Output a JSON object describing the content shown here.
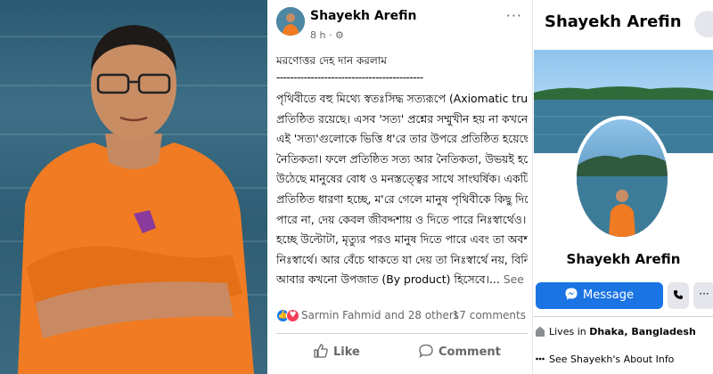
{
  "post": {
    "author": "Shayekh Arefin",
    "time": "8 h",
    "privacy_icon": "gear-icon",
    "more_icon": "more-icon",
    "title": "মরণোত্তর দেহ দান করলাম",
    "divider": "-------------------------------------------",
    "body_lines": [
      "পৃথিবীতে বহু মিথ্যে স্বতঃসিদ্ধ সত্যরূপে (Axiomatic truth)",
      "প্রতিষ্ঠিত রয়েছে। এসব 'সত্য' প্রশ্নের সম্মুখীন হয় না কখনো।",
      "এই 'সত্য'গুলোকে ভিত্তি ধ'রে তার উপরে প্রতিষ্ঠিত হয়েছে বিচিত্র",
      "নৈতিকতা। ফলে প্রতিষ্ঠিত সত্য আর নৈতিকতা, উভয়ই হয়ে",
      "উঠেছে মানুষের বোধ ও মনস্তত্ত্বের সাথে সাংঘর্ষিক। একটি",
      "প্রতিষ্ঠিত ধারণা হচ্ছে, ম'রে গেলে মানুষ পৃথিবীকে কিছু দিতে",
      "পারে না, দেয় কেবল জীবদ্দশায় ও দিতে পারে নিঃস্বার্থেও। সত্য",
      "হচ্ছে উল্টোটা, মৃত্যুর পরও মানুষ দিতে পারে এবং তা অবশ্যই",
      "নিঃস্বার্থে। আর বেঁচে থাকতে যা দেয় তা নিঃস্বার্থে নয়, বিনিময়ে,"
    ],
    "last_line": "আবার কখনো উপজাত (By product) হিসেবে।...",
    "see_more": "See more",
    "reaction_people": "Sarmin Fahmid and 28 others",
    "comments_count": "17 comments",
    "like_label": "Like",
    "comment_label": "Comment"
  },
  "profile": {
    "name": "Shayekh Arefin",
    "message_label": "Message",
    "lives_prefix": "Lives in",
    "lives_place": "Dhaka, Bangladesh",
    "about_label": "See Shayekh's About Info"
  },
  "colors": {
    "primary": "#1b74e4",
    "like": "#1877f2",
    "love": "#f33e58",
    "shirt": "#f07b22"
  }
}
